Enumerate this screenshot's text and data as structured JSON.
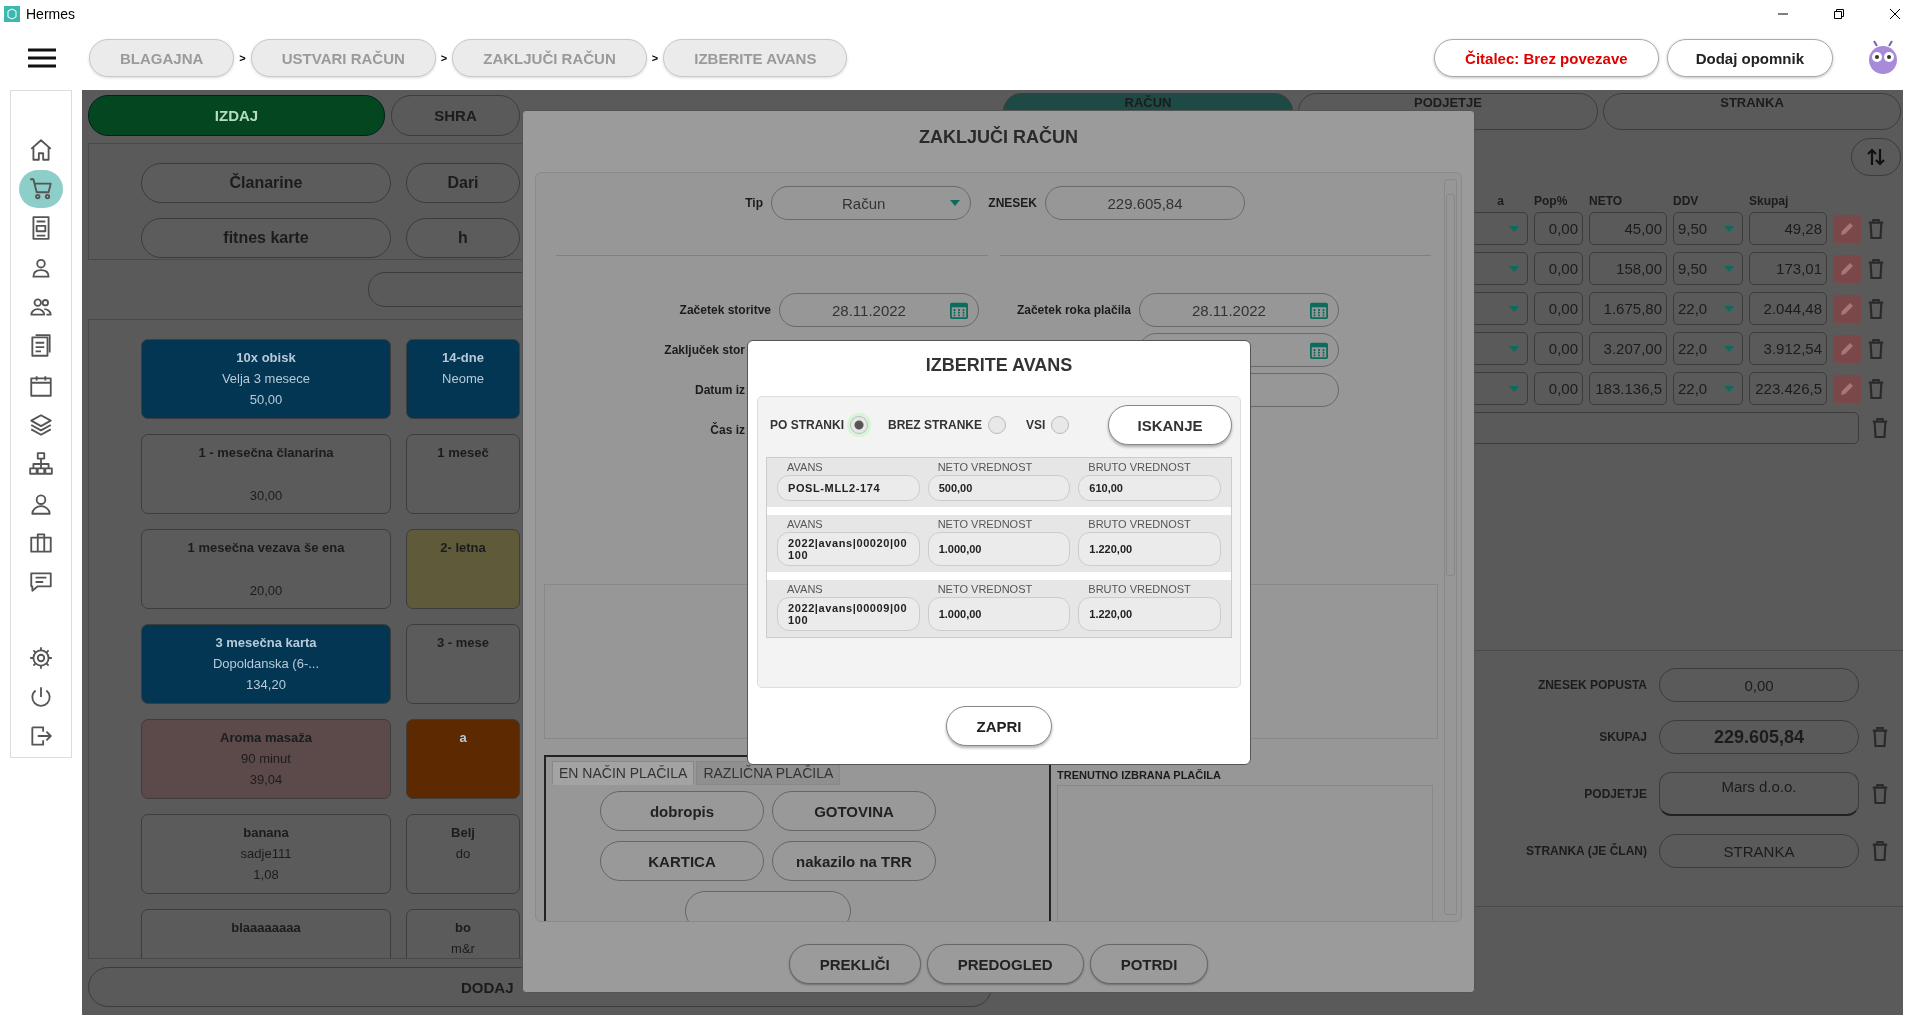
{
  "window": {
    "title": "Hermes"
  },
  "breadcrumbs": [
    {
      "label": "BLAGAJNA",
      "separator": ">"
    },
    {
      "label": "USTVARI RAČUN",
      "separator": ">"
    },
    {
      "label": "ZAKLJUČI RAČUN",
      "separator": ">"
    },
    {
      "label": "IZBERITE AVANS"
    }
  ],
  "header_buttons": [
    {
      "label": "Čitalec: Brez povezave",
      "kind": "alert"
    },
    {
      "label": "Dodaj opomnik",
      "kind": "plain"
    }
  ],
  "sidebar": {
    "items": [
      {
        "kind": "home",
        "selected": false
      },
      {
        "kind": "cart",
        "selected": true
      },
      {
        "kind": "document",
        "selected": false
      },
      {
        "kind": "person",
        "selected": false
      },
      {
        "kind": "people",
        "selected": false
      },
      {
        "kind": "list",
        "selected": false
      },
      {
        "kind": "calendar",
        "selected": false
      },
      {
        "kind": "layers",
        "selected": false
      },
      {
        "kind": "hierarchy",
        "selected": false
      },
      {
        "kind": "badge",
        "selected": false
      },
      {
        "kind": "briefcase",
        "selected": false
      },
      {
        "kind": "chat",
        "selected": false
      },
      {
        "kind": "gear",
        "selected": false
      },
      {
        "kind": "power",
        "selected": false
      },
      {
        "kind": "exit",
        "selected": false
      }
    ]
  },
  "left_panel": {
    "tabs": [
      {
        "label": "IZDAJ",
        "selected": true
      },
      {
        "label": "SHRA",
        "selected": false
      }
    ],
    "categories": [
      "Članarine",
      "Dari",
      "fitnes karte",
      "h"
    ],
    "products": [
      {
        "name": "10x obisk",
        "subtitle": "Velja 3 mesece",
        "price": "50,00",
        "color": "#033652"
      },
      {
        "name": "14-dne",
        "subtitle": "Neome",
        "color": "#033652"
      },
      {
        "name": "1 - mesečna članarina",
        "price": "30,00",
        "color": "#5b5b5b"
      },
      {
        "name": "1 meseč",
        "color": "#5b5b5b"
      },
      {
        "name": "1 mesečna vezava še ena",
        "price": "20,00",
        "color": "#5b5b5b"
      },
      {
        "name": "2- letna",
        "color": "#5e5a3a"
      },
      {
        "name": "3 mesečna karta",
        "subtitle": "Dopoldanska (6-...",
        "price": "134,20",
        "color": "#033652"
      },
      {
        "name": "3 - mese",
        "color": "#5b5b5b"
      },
      {
        "name": "Aroma masaža",
        "subtitle": "90 minut",
        "price": "39,04",
        "color": "#5c4a4b"
      },
      {
        "name": "a",
        "color": "#5c2900"
      },
      {
        "name": "banana",
        "subtitle": "sadje111",
        "price": "1,08",
        "color": "#5b5b5b"
      },
      {
        "name": "Belj",
        "subtitle": "do",
        "color": "#5b5b5b"
      },
      {
        "name": "blaaaaaaaa",
        "color": "#5b5b5b"
      },
      {
        "name": "bo",
        "subtitle": "m&r",
        "color": "#5b5b5b"
      }
    ],
    "add_button": "DODAJ"
  },
  "right_panel": {
    "tabs": [
      {
        "label": "RAČUN",
        "selected": true
      },
      {
        "label": "PODJETJE",
        "selected": false
      },
      {
        "label": "STRANKA",
        "selected": false
      }
    ],
    "columns": [
      "a",
      "Pop%",
      "NETO",
      "DDV",
      "Skupaj"
    ],
    "rows": [
      {
        "pop": "0,00",
        "neto": "45,00",
        "ddv": "9,50",
        "total": "49,28"
      },
      {
        "pop": "0,00",
        "neto": "158,00",
        "ddv": "9,50",
        "total": "173,01"
      },
      {
        "pop": "0,00",
        "neto": "1.675,80",
        "ddv": "22,0",
        "total": "2.044,48"
      },
      {
        "pop": "0,00",
        "neto": "3.207,00",
        "ddv": "22,0",
        "total": "3.912,54"
      },
      {
        "pop": "0,00",
        "neto": "183.136,5",
        "ddv": "22,0",
        "total": "223.426,5"
      }
    ],
    "summary": [
      {
        "label": "ZNESEK POPUSTA",
        "value": "0,00",
        "kind": "plain",
        "deletable": false
      },
      {
        "label": "SKUPAJ",
        "value": "229.605,84",
        "kind": "total",
        "deletable": true
      },
      {
        "label": "PODJETJE",
        "value": "Mars d.o.o.",
        "kind": "multiline",
        "deletable": true
      },
      {
        "label": "STRANKA (JE ČLAN)",
        "value": "STRANKA",
        "kind": "plain",
        "deletable": true
      }
    ]
  },
  "close_invoice_dialog": {
    "title": "ZAKLJUČI RAČUN",
    "type_label": "Tip",
    "type_value": "Račun",
    "amount_label": "ZNESEK",
    "amount": "229.605,84",
    "fields_left": [
      {
        "label": "Začetek storitve",
        "value": "28.11.2022",
        "kind": "date"
      },
      {
        "label": "Zaključek stor",
        "kind": "covered"
      },
      {
        "label": "Datum iz",
        "kind": "covered"
      },
      {
        "label": "Čas iz",
        "kind": "covered"
      }
    ],
    "fields_right": [
      {
        "label": "Začetek roka plačila",
        "value": "28.11.2022",
        "kind": "date"
      },
      {
        "kind": "date"
      },
      {
        "kind": "text"
      }
    ],
    "payment_tabs": [
      {
        "label": "EN NAČIN PLAČILA",
        "selected": true
      },
      {
        "label": "RAZLIČNA PLAČILA",
        "selected": false
      }
    ],
    "payment_methods": [
      "dobropis",
      "GOTOVINA",
      "KARTICA",
      "nakazilo na TRR"
    ],
    "selected_payments_label": "TRENUTNO IZBRANA PLAČILA",
    "buttons": [
      "PREKLIČI",
      "PREDOGLED",
      "POTRDI"
    ]
  },
  "advance_dialog": {
    "title": "IZBERITE AVANS",
    "filters": [
      {
        "label": "PO STRANKI",
        "selected": true
      },
      {
        "label": "BREZ STRANKE",
        "selected": false
      },
      {
        "label": "VSI",
        "selected": false
      }
    ],
    "search_button": "ISKANJE",
    "rows": [
      {
        "avans_label": "AVANS",
        "avans": "POSL-MLL2-174",
        "neto_label": "NETO VREDNOST",
        "neto": "500,00",
        "bruto_label": "BRUTO VREDNOST",
        "bruto": "610,00"
      },
      {
        "avans_label": "AVANS",
        "avans": "2022|avans|00020|00100",
        "neto_label": "NETO VREDNOST",
        "neto": "1.000,00",
        "bruto_label": "BRUTO VREDNOST",
        "bruto": "1.220,00"
      },
      {
        "avans_label": "AVANS",
        "avans": "2022|avans|00009|00100",
        "neto_label": "NETO VREDNOST",
        "neto": "1.000,00",
        "bruto_label": "BRUTO VREDNOST",
        "bruto": "1.220,00"
      }
    ],
    "close_button": "ZAPRI"
  }
}
